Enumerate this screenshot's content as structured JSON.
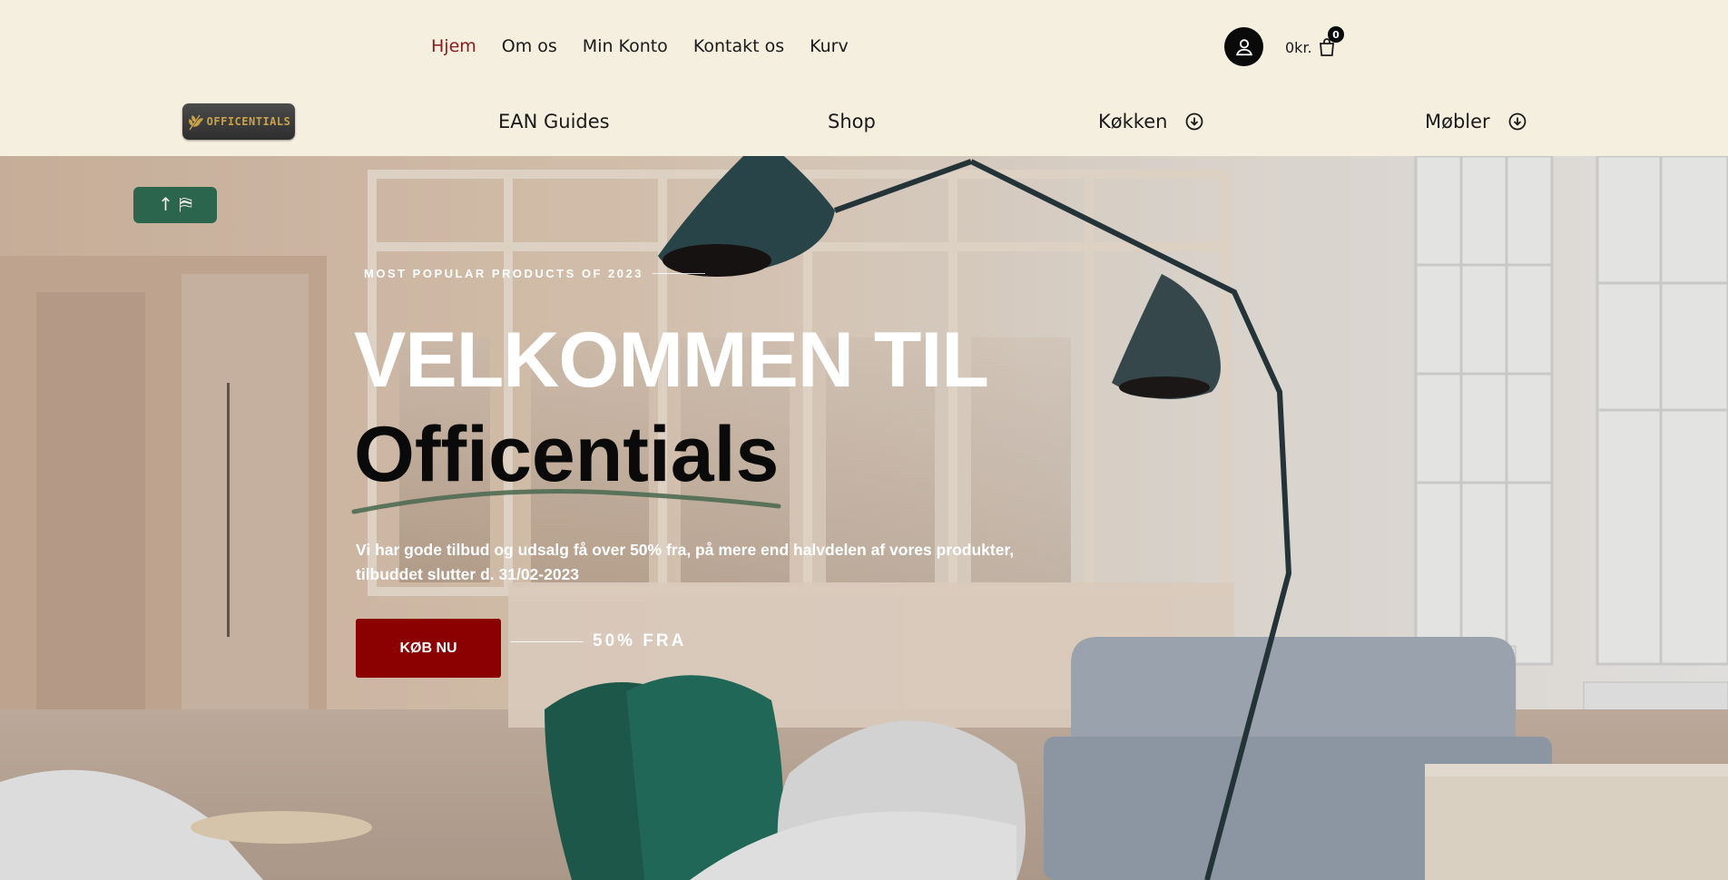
{
  "top_nav": [
    {
      "label": "Hjem",
      "active": true
    },
    {
      "label": "Om os",
      "active": false
    },
    {
      "label": "Min Konto",
      "active": false
    },
    {
      "label": "Kontakt os",
      "active": false
    },
    {
      "label": "Kurv",
      "active": false
    }
  ],
  "account": {
    "icon": "user-icon"
  },
  "cart": {
    "amount": "0kr.",
    "count": "0",
    "icon": "shopping-bag-icon"
  },
  "logo": {
    "text": "OFFICENTIALS",
    "icon": "wheat-icon"
  },
  "main_nav": [
    {
      "label": "EAN Guides"
    },
    {
      "label": "Shop"
    },
    {
      "label": "Køkken",
      "icon": "circle-arrow-down-icon"
    },
    {
      "label": "Møbler",
      "icon": "circle-arrow-down-icon"
    }
  ],
  "hero": {
    "eyebrow": "MOST POPULAR PRODUCTS OF 2023",
    "headline_line1": "VELKOMMEN TIL",
    "headline_line2": "Officentials",
    "description": "Vi har gode tilbud og udsalg få over 50% fra, på mere end halvdelen af vores produkter, tilbuddet slutter d. 31/02-2023",
    "cta_label": "KØB NU",
    "offer_text": "50% FRA"
  },
  "colors": {
    "background": "#f5efe0",
    "accent": "#8b1a1a",
    "cta": "#8b0000",
    "dark": "#0a0a0a"
  }
}
